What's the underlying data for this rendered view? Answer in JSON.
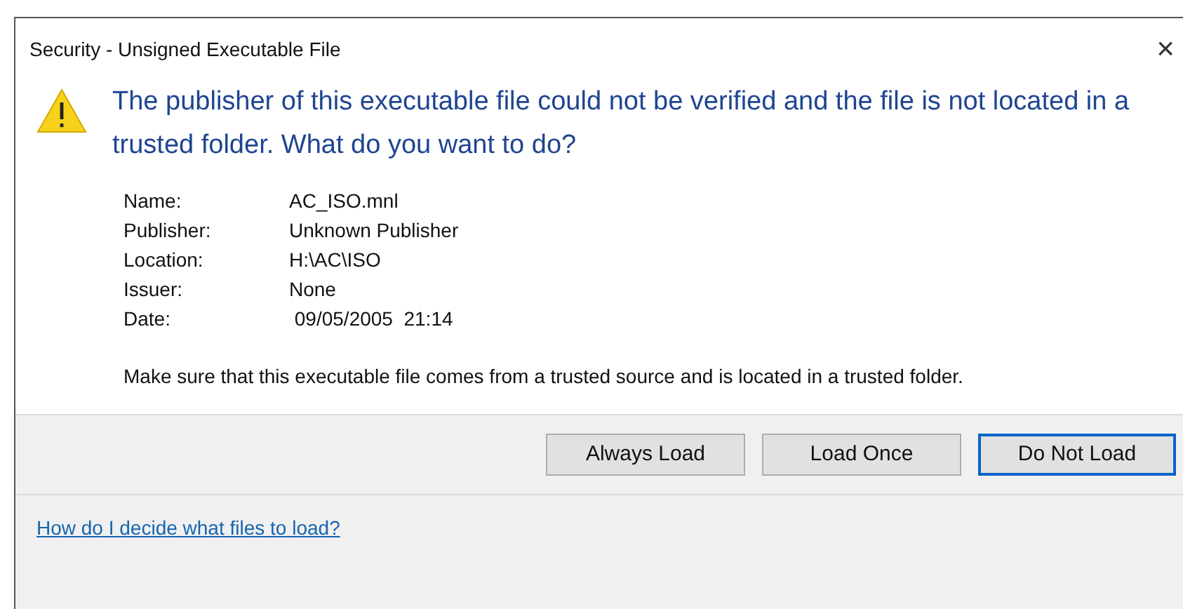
{
  "window": {
    "title": "Security - Unsigned Executable File",
    "close": "×"
  },
  "heading": "The publisher of this executable file could not be verified and the file is not located in a trusted folder. What do you want to do?",
  "details": [
    {
      "label": "Name:",
      "value": "AC_ISO.mnl"
    },
    {
      "label": "Publisher:",
      "value": "Unknown Publisher"
    },
    {
      "label": "Location:",
      "value": "H:\\AC\\ISO"
    },
    {
      "label": "Issuer:",
      "value": "None"
    },
    {
      "label": "Date:",
      "value": " 09/05/2005  21:14"
    }
  ],
  "note": "Make sure that this executable file comes from a trusted source and is located in a trusted folder.",
  "buttons": [
    {
      "label": "Always Load",
      "default": false
    },
    {
      "label": "Load Once",
      "default": false
    },
    {
      "label": "Do Not Load",
      "default": true
    }
  ],
  "help_link": "How do I decide what files to load?"
}
